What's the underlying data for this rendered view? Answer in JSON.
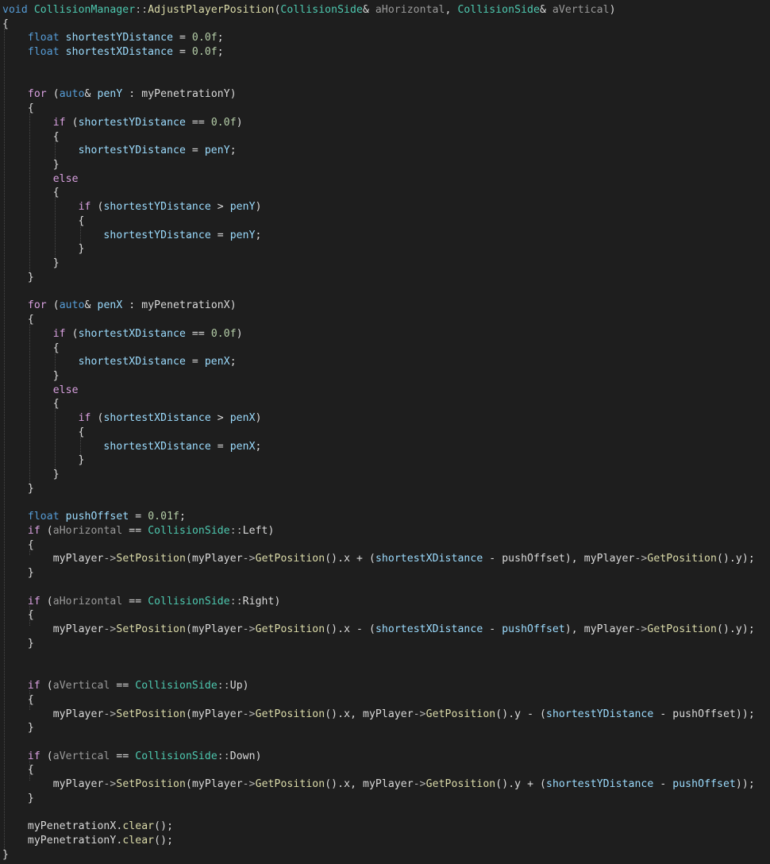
{
  "code_lines": [
    [
      {
        "t": "void",
        "c": "t-keyword"
      },
      {
        "t": " ",
        "c": "t-plain"
      },
      {
        "t": "CollisionManager",
        "c": "t-type"
      },
      {
        "t": "::",
        "c": "t-punct"
      },
      {
        "t": "AdjustPlayerPosition",
        "c": "t-function"
      },
      {
        "t": "(",
        "c": "t-plain"
      },
      {
        "t": "CollisionSide",
        "c": "t-type"
      },
      {
        "t": "& ",
        "c": "t-plain"
      },
      {
        "t": "aHorizontal",
        "c": "t-param"
      },
      {
        "t": ", ",
        "c": "t-plain"
      },
      {
        "t": "CollisionSide",
        "c": "t-type"
      },
      {
        "t": "& ",
        "c": "t-plain"
      },
      {
        "t": "aVertical",
        "c": "t-param"
      },
      {
        "t": ")",
        "c": "t-plain"
      }
    ],
    [
      {
        "t": "{",
        "c": "t-plain"
      }
    ],
    [
      {
        "t": "    ",
        "c": "t-plain"
      },
      {
        "t": "float",
        "c": "t-keyword"
      },
      {
        "t": " ",
        "c": "t-plain"
      },
      {
        "t": "shortestYDistance",
        "c": "t-local"
      },
      {
        "t": " = ",
        "c": "t-plain"
      },
      {
        "t": "0.0f",
        "c": "t-number"
      },
      {
        "t": ";",
        "c": "t-plain"
      }
    ],
    [
      {
        "t": "    ",
        "c": "t-plain"
      },
      {
        "t": "float",
        "c": "t-keyword"
      },
      {
        "t": " ",
        "c": "t-plain"
      },
      {
        "t": "shortestXDistance",
        "c": "t-local"
      },
      {
        "t": " = ",
        "c": "t-plain"
      },
      {
        "t": "0.0f",
        "c": "t-number"
      },
      {
        "t": ";",
        "c": "t-plain"
      }
    ],
    [],
    [],
    [
      {
        "t": "    ",
        "c": "t-plain"
      },
      {
        "t": "for",
        "c": "t-control"
      },
      {
        "t": " (",
        "c": "t-plain"
      },
      {
        "t": "auto",
        "c": "t-keyword"
      },
      {
        "t": "& ",
        "c": "t-plain"
      },
      {
        "t": "penY",
        "c": "t-local"
      },
      {
        "t": " : ",
        "c": "t-plain"
      },
      {
        "t": "myPenetrationY",
        "c": "t-field"
      },
      {
        "t": ")",
        "c": "t-plain"
      }
    ],
    [
      {
        "t": "    {",
        "c": "t-plain"
      }
    ],
    [
      {
        "t": "        ",
        "c": "t-plain"
      },
      {
        "t": "if",
        "c": "t-control"
      },
      {
        "t": " (",
        "c": "t-plain"
      },
      {
        "t": "shortestYDistance",
        "c": "t-local"
      },
      {
        "t": " == ",
        "c": "t-plain"
      },
      {
        "t": "0.0f",
        "c": "t-number"
      },
      {
        "t": ")",
        "c": "t-plain"
      }
    ],
    [
      {
        "t": "        {",
        "c": "t-plain"
      }
    ],
    [
      {
        "t": "            ",
        "c": "t-plain"
      },
      {
        "t": "shortestYDistance",
        "c": "t-local"
      },
      {
        "t": " = ",
        "c": "t-plain"
      },
      {
        "t": "penY",
        "c": "t-local"
      },
      {
        "t": ";",
        "c": "t-plain"
      }
    ],
    [
      {
        "t": "        }",
        "c": "t-plain"
      }
    ],
    [
      {
        "t": "        ",
        "c": "t-plain"
      },
      {
        "t": "else",
        "c": "t-control"
      }
    ],
    [
      {
        "t": "        {",
        "c": "t-plain"
      }
    ],
    [
      {
        "t": "            ",
        "c": "t-plain"
      },
      {
        "t": "if",
        "c": "t-control"
      },
      {
        "t": " (",
        "c": "t-plain"
      },
      {
        "t": "shortestYDistance",
        "c": "t-local"
      },
      {
        "t": " > ",
        "c": "t-plain"
      },
      {
        "t": "penY",
        "c": "t-local"
      },
      {
        "t": ")",
        "c": "t-plain"
      }
    ],
    [
      {
        "t": "            {",
        "c": "t-plain"
      }
    ],
    [
      {
        "t": "                ",
        "c": "t-plain"
      },
      {
        "t": "shortestYDistance",
        "c": "t-local"
      },
      {
        "t": " = ",
        "c": "t-plain"
      },
      {
        "t": "penY",
        "c": "t-local"
      },
      {
        "t": ";",
        "c": "t-plain"
      }
    ],
    [
      {
        "t": "            }",
        "c": "t-plain"
      }
    ],
    [
      {
        "t": "        }",
        "c": "t-plain"
      }
    ],
    [
      {
        "t": "    }",
        "c": "t-plain"
      }
    ],
    [],
    [
      {
        "t": "    ",
        "c": "t-plain"
      },
      {
        "t": "for",
        "c": "t-control"
      },
      {
        "t": " (",
        "c": "t-plain"
      },
      {
        "t": "auto",
        "c": "t-keyword"
      },
      {
        "t": "& ",
        "c": "t-plain"
      },
      {
        "t": "penX",
        "c": "t-local"
      },
      {
        "t": " : ",
        "c": "t-plain"
      },
      {
        "t": "myPenetrationX",
        "c": "t-field"
      },
      {
        "t": ")",
        "c": "t-plain"
      }
    ],
    [
      {
        "t": "    {",
        "c": "t-plain"
      }
    ],
    [
      {
        "t": "        ",
        "c": "t-plain"
      },
      {
        "t": "if",
        "c": "t-control"
      },
      {
        "t": " (",
        "c": "t-plain"
      },
      {
        "t": "shortestXDistance",
        "c": "t-local"
      },
      {
        "t": " == ",
        "c": "t-plain"
      },
      {
        "t": "0.0f",
        "c": "t-number"
      },
      {
        "t": ")",
        "c": "t-plain"
      }
    ],
    [
      {
        "t": "        {",
        "c": "t-plain"
      }
    ],
    [
      {
        "t": "            ",
        "c": "t-plain"
      },
      {
        "t": "shortestXDistance",
        "c": "t-local"
      },
      {
        "t": " = ",
        "c": "t-plain"
      },
      {
        "t": "penX",
        "c": "t-local"
      },
      {
        "t": ";",
        "c": "t-plain"
      }
    ],
    [
      {
        "t": "        }",
        "c": "t-plain"
      }
    ],
    [
      {
        "t": "        ",
        "c": "t-plain"
      },
      {
        "t": "else",
        "c": "t-control"
      }
    ],
    [
      {
        "t": "        {",
        "c": "t-plain"
      }
    ],
    [
      {
        "t": "            ",
        "c": "t-plain"
      },
      {
        "t": "if",
        "c": "t-control"
      },
      {
        "t": " (",
        "c": "t-plain"
      },
      {
        "t": "shortestXDistance",
        "c": "t-local"
      },
      {
        "t": " > ",
        "c": "t-plain"
      },
      {
        "t": "penX",
        "c": "t-local"
      },
      {
        "t": ")",
        "c": "t-plain"
      }
    ],
    [
      {
        "t": "            {",
        "c": "t-plain"
      }
    ],
    [
      {
        "t": "                ",
        "c": "t-plain"
      },
      {
        "t": "shortestXDistance",
        "c": "t-local"
      },
      {
        "t": " = ",
        "c": "t-plain"
      },
      {
        "t": "penX",
        "c": "t-local"
      },
      {
        "t": ";",
        "c": "t-plain"
      }
    ],
    [
      {
        "t": "            }",
        "c": "t-plain"
      }
    ],
    [
      {
        "t": "        }",
        "c": "t-plain"
      }
    ],
    [
      {
        "t": "    }",
        "c": "t-plain"
      }
    ],
    [],
    [
      {
        "t": "    ",
        "c": "t-plain"
      },
      {
        "t": "float",
        "c": "t-keyword"
      },
      {
        "t": " ",
        "c": "t-plain"
      },
      {
        "t": "pushOffset",
        "c": "t-local"
      },
      {
        "t": " = ",
        "c": "t-plain"
      },
      {
        "t": "0.01f",
        "c": "t-number"
      },
      {
        "t": ";",
        "c": "t-plain"
      }
    ],
    [
      {
        "t": "    ",
        "c": "t-plain"
      },
      {
        "t": "if",
        "c": "t-control"
      },
      {
        "t": " (",
        "c": "t-plain"
      },
      {
        "t": "aHorizontal",
        "c": "t-param"
      },
      {
        "t": " == ",
        "c": "t-plain"
      },
      {
        "t": "CollisionSide",
        "c": "t-type"
      },
      {
        "t": "::",
        "c": "t-punct"
      },
      {
        "t": "Left",
        "c": "t-field"
      },
      {
        "t": ")",
        "c": "t-plain"
      }
    ],
    [
      {
        "t": "    {",
        "c": "t-plain"
      }
    ],
    [
      {
        "t": "        ",
        "c": "t-plain"
      },
      {
        "t": "myPlayer",
        "c": "t-field"
      },
      {
        "t": "->",
        "c": "t-punct"
      },
      {
        "t": "SetPosition",
        "c": "t-function"
      },
      {
        "t": "(",
        "c": "t-plain"
      },
      {
        "t": "myPlayer",
        "c": "t-field"
      },
      {
        "t": "->",
        "c": "t-punct"
      },
      {
        "t": "GetPosition",
        "c": "t-function"
      },
      {
        "t": "().x + (",
        "c": "t-plain"
      },
      {
        "t": "shortestXDistance",
        "c": "t-local"
      },
      {
        "t": " - ",
        "c": "t-plain"
      },
      {
        "t": "pushOffset",
        "c": "t-field"
      },
      {
        "t": "), ",
        "c": "t-plain"
      },
      {
        "t": "myPlayer",
        "c": "t-field"
      },
      {
        "t": "->",
        "c": "t-punct"
      },
      {
        "t": "GetPosition",
        "c": "t-function"
      },
      {
        "t": "().y);",
        "c": "t-plain"
      }
    ],
    [
      {
        "t": "    }",
        "c": "t-plain"
      }
    ],
    [],
    [
      {
        "t": "    ",
        "c": "t-plain"
      },
      {
        "t": "if",
        "c": "t-control"
      },
      {
        "t": " (",
        "c": "t-plain"
      },
      {
        "t": "aHorizontal",
        "c": "t-param"
      },
      {
        "t": " == ",
        "c": "t-plain"
      },
      {
        "t": "CollisionSide",
        "c": "t-type"
      },
      {
        "t": "::",
        "c": "t-punct"
      },
      {
        "t": "Right",
        "c": "t-field"
      },
      {
        "t": ")",
        "c": "t-plain"
      }
    ],
    [
      {
        "t": "    {",
        "c": "t-plain"
      }
    ],
    [
      {
        "t": "        ",
        "c": "t-plain"
      },
      {
        "t": "myPlayer",
        "c": "t-field"
      },
      {
        "t": "->",
        "c": "t-punct"
      },
      {
        "t": "SetPosition",
        "c": "t-function"
      },
      {
        "t": "(",
        "c": "t-plain"
      },
      {
        "t": "myPlayer",
        "c": "t-field"
      },
      {
        "t": "->",
        "c": "t-punct"
      },
      {
        "t": "GetPosition",
        "c": "t-function"
      },
      {
        "t": "().x - (",
        "c": "t-plain"
      },
      {
        "t": "shortestXDistance",
        "c": "t-local"
      },
      {
        "t": " - ",
        "c": "t-plain"
      },
      {
        "t": "pushOffset",
        "c": "t-local"
      },
      {
        "t": "), ",
        "c": "t-plain"
      },
      {
        "t": "myPlayer",
        "c": "t-field"
      },
      {
        "t": "->",
        "c": "t-punct"
      },
      {
        "t": "GetPosition",
        "c": "t-function"
      },
      {
        "t": "().y);",
        "c": "t-plain"
      }
    ],
    [
      {
        "t": "    }",
        "c": "t-plain"
      }
    ],
    [],
    [],
    [
      {
        "t": "    ",
        "c": "t-plain"
      },
      {
        "t": "if",
        "c": "t-control"
      },
      {
        "t": " (",
        "c": "t-plain"
      },
      {
        "t": "aVertical",
        "c": "t-param"
      },
      {
        "t": " == ",
        "c": "t-plain"
      },
      {
        "t": "CollisionSide",
        "c": "t-type"
      },
      {
        "t": "::",
        "c": "t-punct"
      },
      {
        "t": "Up",
        "c": "t-field"
      },
      {
        "t": ")",
        "c": "t-plain"
      }
    ],
    [
      {
        "t": "    {",
        "c": "t-plain"
      }
    ],
    [
      {
        "t": "        ",
        "c": "t-plain"
      },
      {
        "t": "myPlayer",
        "c": "t-field"
      },
      {
        "t": "->",
        "c": "t-punct"
      },
      {
        "t": "SetPosition",
        "c": "t-function"
      },
      {
        "t": "(",
        "c": "t-plain"
      },
      {
        "t": "myPlayer",
        "c": "t-field"
      },
      {
        "t": "->",
        "c": "t-punct"
      },
      {
        "t": "GetPosition",
        "c": "t-function"
      },
      {
        "t": "().x, ",
        "c": "t-plain"
      },
      {
        "t": "myPlayer",
        "c": "t-field"
      },
      {
        "t": "->",
        "c": "t-punct"
      },
      {
        "t": "GetPosition",
        "c": "t-function"
      },
      {
        "t": "().y - (",
        "c": "t-plain"
      },
      {
        "t": "shortestYDistance",
        "c": "t-local"
      },
      {
        "t": " - ",
        "c": "t-plain"
      },
      {
        "t": "pushOffset",
        "c": "t-field"
      },
      {
        "t": "));",
        "c": "t-plain"
      }
    ],
    [
      {
        "t": "    }",
        "c": "t-plain"
      }
    ],
    [],
    [
      {
        "t": "    ",
        "c": "t-plain"
      },
      {
        "t": "if",
        "c": "t-control"
      },
      {
        "t": " (",
        "c": "t-plain"
      },
      {
        "t": "aVertical",
        "c": "t-param"
      },
      {
        "t": " == ",
        "c": "t-plain"
      },
      {
        "t": "CollisionSide",
        "c": "t-type"
      },
      {
        "t": "::",
        "c": "t-punct"
      },
      {
        "t": "Down",
        "c": "t-field"
      },
      {
        "t": ")",
        "c": "t-plain"
      }
    ],
    [
      {
        "t": "    {",
        "c": "t-plain"
      }
    ],
    [
      {
        "t": "        ",
        "c": "t-plain"
      },
      {
        "t": "myPlayer",
        "c": "t-field"
      },
      {
        "t": "->",
        "c": "t-punct"
      },
      {
        "t": "SetPosition",
        "c": "t-function"
      },
      {
        "t": "(",
        "c": "t-plain"
      },
      {
        "t": "myPlayer",
        "c": "t-field"
      },
      {
        "t": "->",
        "c": "t-punct"
      },
      {
        "t": "GetPosition",
        "c": "t-function"
      },
      {
        "t": "().x, ",
        "c": "t-plain"
      },
      {
        "t": "myPlayer",
        "c": "t-field"
      },
      {
        "t": "->",
        "c": "t-punct"
      },
      {
        "t": "GetPosition",
        "c": "t-function"
      },
      {
        "t": "().y + (",
        "c": "t-plain"
      },
      {
        "t": "shortestYDistance",
        "c": "t-local"
      },
      {
        "t": " - ",
        "c": "t-plain"
      },
      {
        "t": "pushOffset",
        "c": "t-local"
      },
      {
        "t": "));",
        "c": "t-plain"
      }
    ],
    [
      {
        "t": "    }",
        "c": "t-plain"
      }
    ],
    [],
    [
      {
        "t": "    ",
        "c": "t-plain"
      },
      {
        "t": "myPenetrationX",
        "c": "t-field"
      },
      {
        "t": ".",
        "c": "t-plain"
      },
      {
        "t": "clear",
        "c": "t-function"
      },
      {
        "t": "();",
        "c": "t-plain"
      }
    ],
    [
      {
        "t": "    ",
        "c": "t-plain"
      },
      {
        "t": "myPenetrationY",
        "c": "t-field"
      },
      {
        "t": ".",
        "c": "t-plain"
      },
      {
        "t": "clear",
        "c": "t-function"
      },
      {
        "t": "();",
        "c": "t-plain"
      }
    ],
    [
      {
        "t": "}",
        "c": "t-plain"
      }
    ]
  ],
  "colors": {
    "background": "#1e1e1e",
    "keyword": "#569cd6",
    "control": "#d8a0df",
    "type": "#4ec9b0",
    "function": "#dcdcaa",
    "parameter": "#9a9a9a",
    "field": "#dadada",
    "local": "#9cdcfe",
    "number": "#b5cea8",
    "guide": "#4a4a4a"
  }
}
